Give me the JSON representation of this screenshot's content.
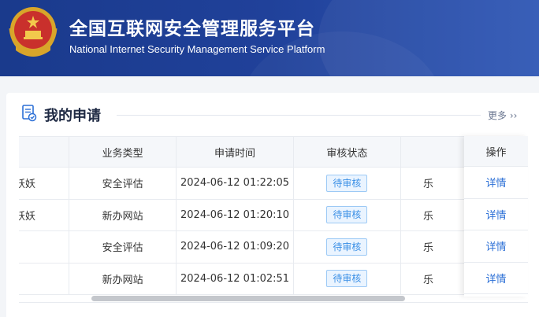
{
  "header": {
    "title_cn": "全国互联网安全管理服务平台",
    "title_en": "National Internet Security Management Service Platform"
  },
  "section": {
    "title": "我的申请",
    "more_label": "更多 ››"
  },
  "table": {
    "columns": [
      "",
      "业务类型",
      "申请时间",
      "审核状态",
      ""
    ],
    "action_header": "操作",
    "rows": [
      {
        "name": "妖妖",
        "type": "安全评估",
        "time": "2024-06-12 01:22:05",
        "status": "待审核",
        "extra": "乐",
        "action": "详情"
      },
      {
        "name": "妖妖",
        "type": "新办网站",
        "time": "2024-06-12 01:20:10",
        "status": "待审核",
        "extra": "乐",
        "action": "详情"
      },
      {
        "name": "",
        "type": "安全评估",
        "time": "2024-06-12 01:09:20",
        "status": "待审核",
        "extra": "乐",
        "action": "详情"
      },
      {
        "name": "",
        "type": "新办网站",
        "time": "2024-06-12 01:02:51",
        "status": "待审核",
        "extra": "乐",
        "action": "详情"
      }
    ]
  },
  "colors": {
    "header_bg": "#20419a",
    "link": "#2b6fd6",
    "badge_text": "#3a8fe6"
  }
}
